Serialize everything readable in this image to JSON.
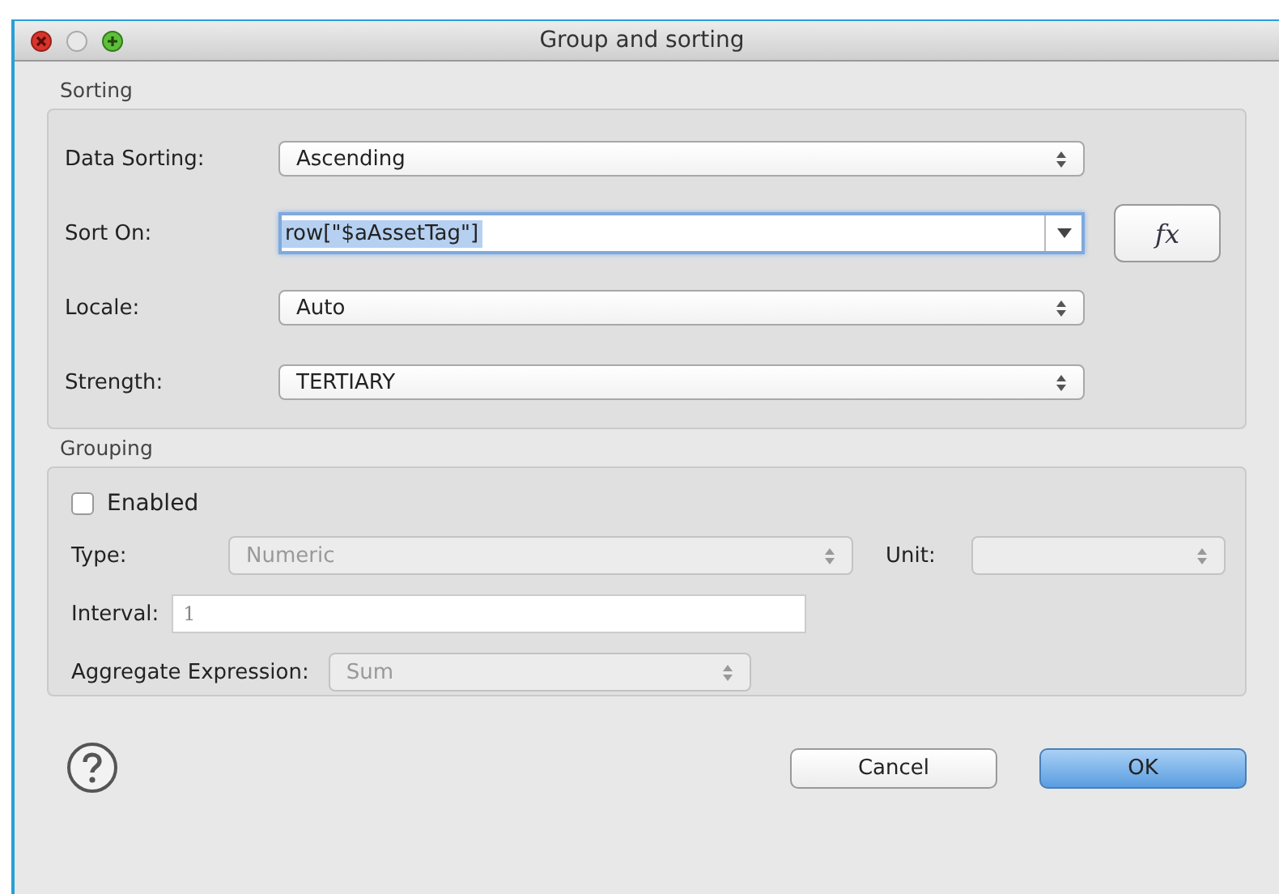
{
  "window": {
    "title": "Group and sorting"
  },
  "sorting": {
    "title": "Sorting",
    "rows": [
      {
        "kind": "select",
        "label": "Data Sorting:",
        "value": "Ascending"
      },
      {
        "kind": "combo",
        "label": "Sort On:",
        "value": "row[\"$aAssetTag\"]",
        "focused": true,
        "button": "fx"
      },
      {
        "kind": "select",
        "label": "Locale:",
        "value": "Auto"
      },
      {
        "kind": "select",
        "label": "Strength:",
        "value": "TERTIARY"
      }
    ]
  },
  "grouping": {
    "title": "Grouping",
    "enabled": {
      "label": "Enabled",
      "checked": false
    },
    "type": {
      "label": "Type:",
      "value": "Numeric",
      "disabled": true
    },
    "unit": {
      "label": "Unit:",
      "disabled": true
    },
    "interval": {
      "label": "Interval:",
      "value": "1",
      "disabled": true
    },
    "aggregate": {
      "label": "Aggregate Expression:",
      "value": "Sum",
      "disabled": true
    }
  },
  "buttons": [
    {
      "label": "Cancel",
      "default": false
    },
    {
      "label": "OK",
      "default": true
    }
  ]
}
